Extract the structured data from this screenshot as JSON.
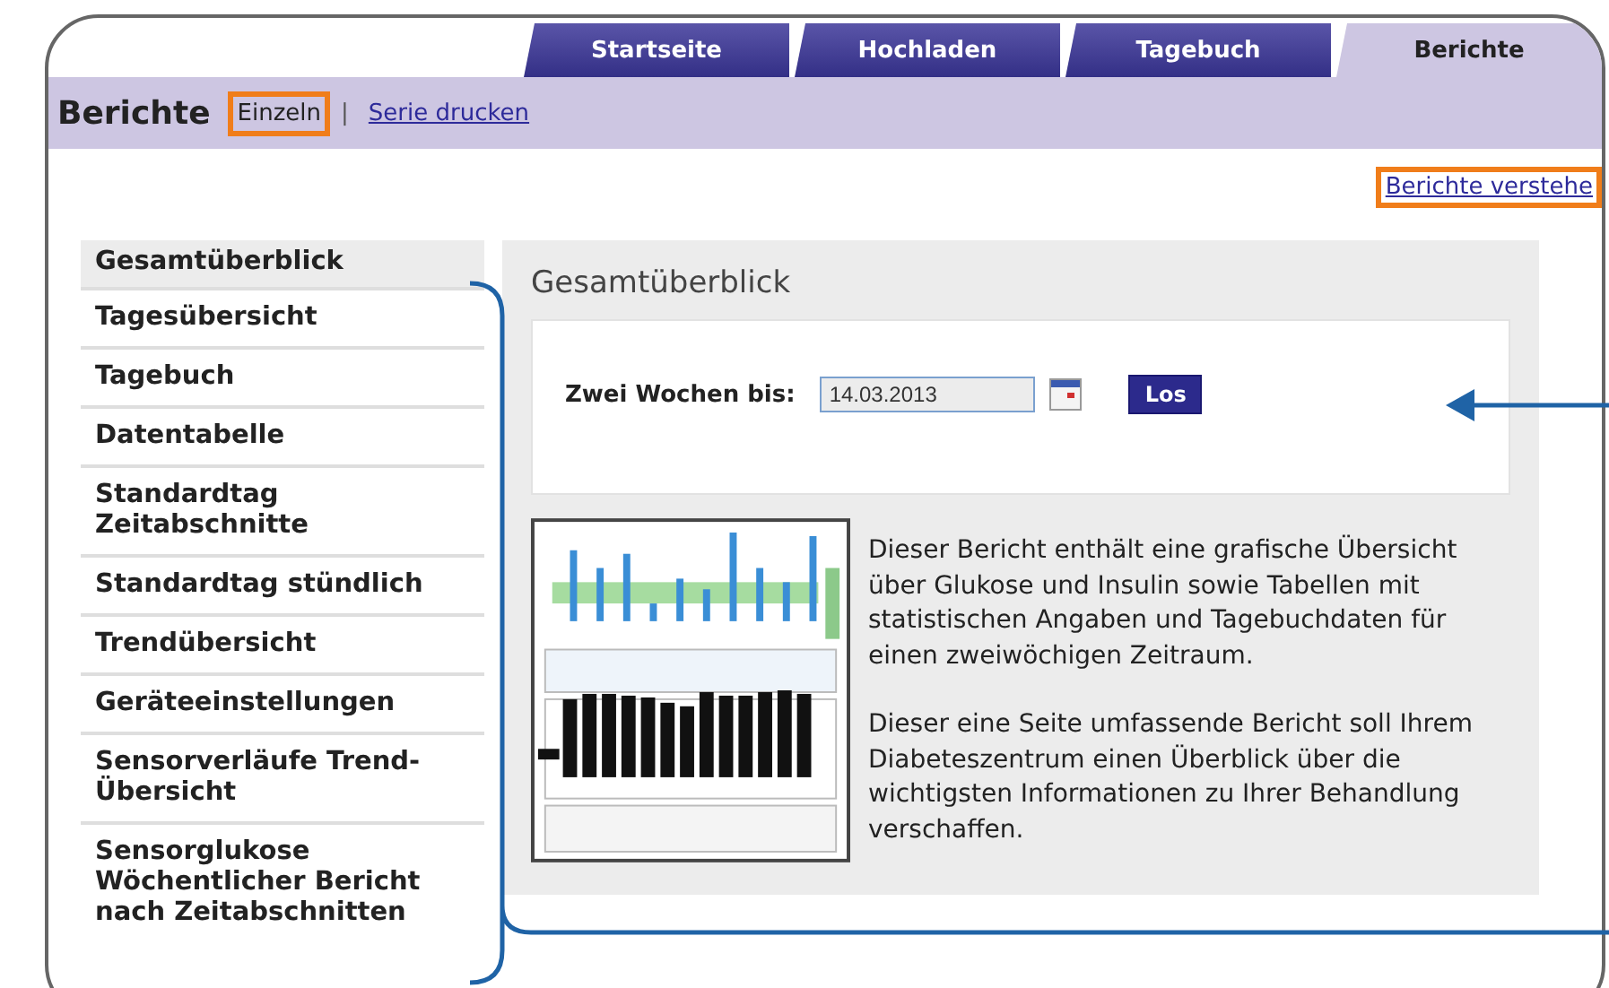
{
  "tabs": [
    {
      "label": "Startseite",
      "selected": false
    },
    {
      "label": "Hochladen",
      "selected": false
    },
    {
      "label": "Tagebuch",
      "selected": false
    },
    {
      "label": "Berichte",
      "selected": true
    }
  ],
  "header": {
    "title": "Berichte",
    "separator": "|",
    "links": [
      {
        "label": "Einzeln",
        "selected": true,
        "highlighted": true
      },
      {
        "label": "Serie drucken",
        "selected": false,
        "highlighted": false
      }
    ]
  },
  "help_link": {
    "label": "Berichte verstehe",
    "highlighted": true
  },
  "sidebar": {
    "items": [
      {
        "label": "Gesamtüberblick",
        "selected": true
      },
      {
        "label": "Tagesübersicht",
        "selected": false
      },
      {
        "label": "Tagebuch",
        "selected": false
      },
      {
        "label": "Datentabelle",
        "selected": false
      },
      {
        "label": "Standardtag Zeitabschnitte",
        "selected": false
      },
      {
        "label": "Standardtag stündlich",
        "selected": false
      },
      {
        "label": "Trendübersicht",
        "selected": false
      },
      {
        "label": "Geräteeinstellungen",
        "selected": false
      },
      {
        "label": "Sensorverläufe Trend-Übersicht",
        "selected": false
      },
      {
        "label": "Sensorglukose Wöchentlicher Bericht nach Zeitabschnitten",
        "selected": false
      }
    ]
  },
  "report": {
    "title": "Gesamtüberblick",
    "date_label": "Zwei Wochen bis:",
    "date_value": "14.03.2013",
    "go_button": "Los",
    "description": [
      "Dieser Bericht enthält eine grafische Übersicht über Glukose und Insulin sowie Tabellen mit statistischen Angaben und Tagebuchdaten für einen zweiwöchigen Zeitraum.",
      "Dieser eine Seite umfassende Bericht soll Ihrem Diabeteszentrum einen Überblick über die wichtigsten Informationen zu Ihrer Behandlung verschaffen."
    ]
  }
}
